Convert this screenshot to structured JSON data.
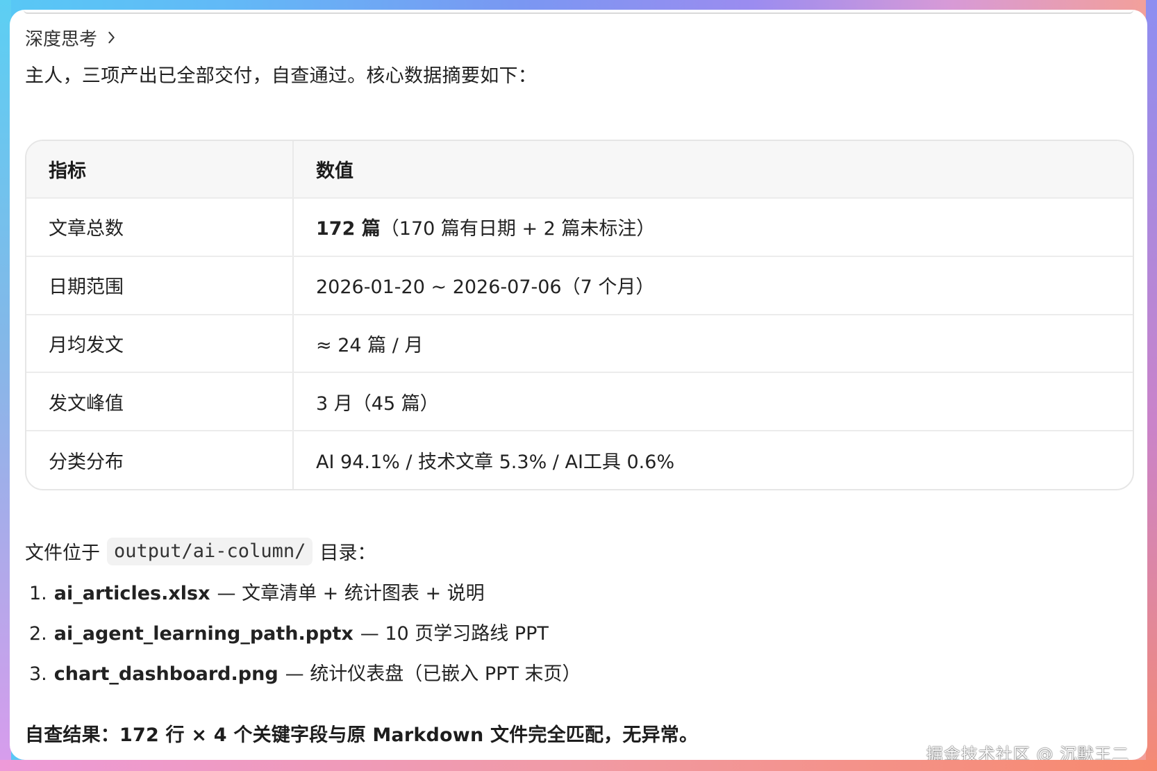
{
  "header": {
    "deep_thinking_label": "深度思考"
  },
  "message": {
    "intro": "主人，三项产出已全部交付，自查通过。核心数据摘要如下："
  },
  "table": {
    "columns": [
      "指标",
      "数值"
    ],
    "rows": [
      {
        "metric": "文章总数",
        "value_strong": "172 篇",
        "value_rest": "（170 篇有日期 + 2 篇未标注）"
      },
      {
        "metric": "日期范围",
        "value": "2026-01-20 ~ 2026-07-06（7 个月）"
      },
      {
        "metric": "月均发文",
        "value": "≈ 24 篇 / 月"
      },
      {
        "metric": "发文峰值",
        "value": "3 月（45 篇）"
      },
      {
        "metric": "分类分布",
        "value": "AI 94.1% / 技术文章 5.3% / AI工具 0.6%"
      }
    ]
  },
  "files": {
    "prefix": "文件位于",
    "path": "output/ai-column/",
    "suffix": "目录：",
    "items": [
      {
        "number": "1.",
        "name": "ai_articles.xlsx",
        "desc": "— 文章清单 + 统计图表 + 说明"
      },
      {
        "number": "2.",
        "name": "ai_agent_learning_path.pptx",
        "desc": "— 10 页学习路线 PPT"
      },
      {
        "number": "3.",
        "name": "chart_dashboard.png",
        "desc": "— 统计仪表盘（已嵌入 PPT 末页）"
      }
    ]
  },
  "summary": {
    "text": "自查结果：172 行 × 4 个关键字段与原 Markdown 文件完全匹配，无异常。"
  },
  "watermark": {
    "text": "掘金技术社区 @ 沉默王二"
  },
  "icons": {
    "chevron": "chevron-right-icon"
  }
}
